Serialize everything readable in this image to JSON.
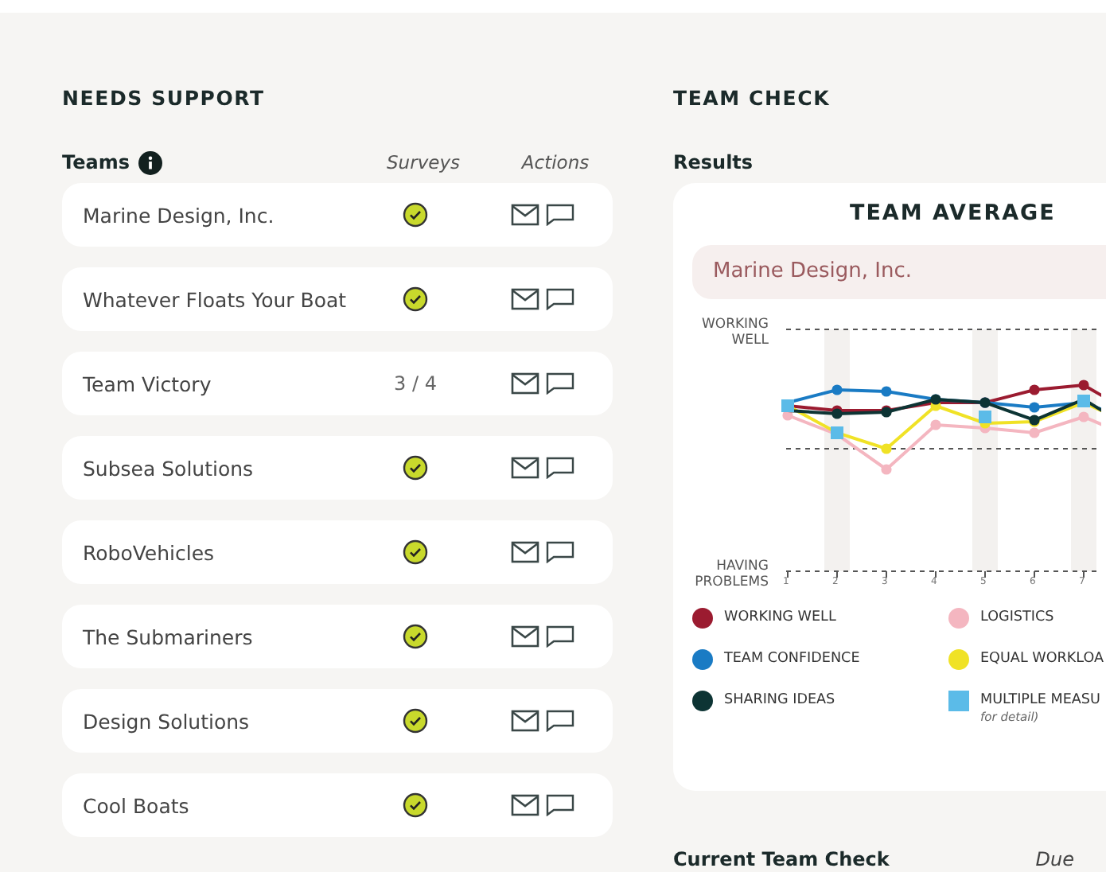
{
  "needs_support": {
    "title": "NEEDS SUPPORT",
    "columns": {
      "teams": "Teams",
      "surveys": "Surveys",
      "actions": "Actions"
    },
    "rows": [
      {
        "name": "Marine Design, Inc.",
        "survey": {
          "kind": "check"
        }
      },
      {
        "name": "Whatever Floats Your Boat",
        "survey": {
          "kind": "check"
        }
      },
      {
        "name": "Team Victory",
        "survey": {
          "kind": "count",
          "text": "3 / 4"
        }
      },
      {
        "name": "Subsea Solutions",
        "survey": {
          "kind": "check"
        }
      },
      {
        "name": "RoboVehicles",
        "survey": {
          "kind": "check"
        }
      },
      {
        "name": "The Submariners",
        "survey": {
          "kind": "check"
        }
      },
      {
        "name": "Design Solutions",
        "survey": {
          "kind": "check"
        }
      },
      {
        "name": "Cool Boats",
        "survey": {
          "kind": "check"
        }
      }
    ]
  },
  "team_check": {
    "title": "TEAM CHECK",
    "results_label": "Results",
    "card": {
      "title": "TEAM AVERAGE",
      "team_select": "Marine Design, Inc.",
      "chart": {
        "top_label": "WORKING WELL",
        "bottom_label": "HAVING PROBLEMS",
        "x_labels": [
          "1",
          "2",
          "3",
          "4",
          "5",
          "6",
          "7"
        ]
      },
      "legend": [
        {
          "label": "WORKING WELL",
          "color": "#9b1b30",
          "kind": "dot"
        },
        {
          "label": "LOGISTICS",
          "color": "#f4b6c0",
          "kind": "dot"
        },
        {
          "label": "TEAM CONFIDENCE",
          "color": "#1a7bc4",
          "kind": "dot"
        },
        {
          "label": "EQUAL WORKLOA",
          "color": "#f0e226",
          "kind": "dot"
        },
        {
          "label": "SHARING IDEAS",
          "color": "#0d3434",
          "kind": "dot"
        },
        {
          "label": "MULTIPLE MEASU",
          "note": "for detail)",
          "color": "#5bbbe8",
          "kind": "square"
        }
      ]
    },
    "current": {
      "label": "Current Team Check",
      "due_label": "Due"
    }
  }
}
